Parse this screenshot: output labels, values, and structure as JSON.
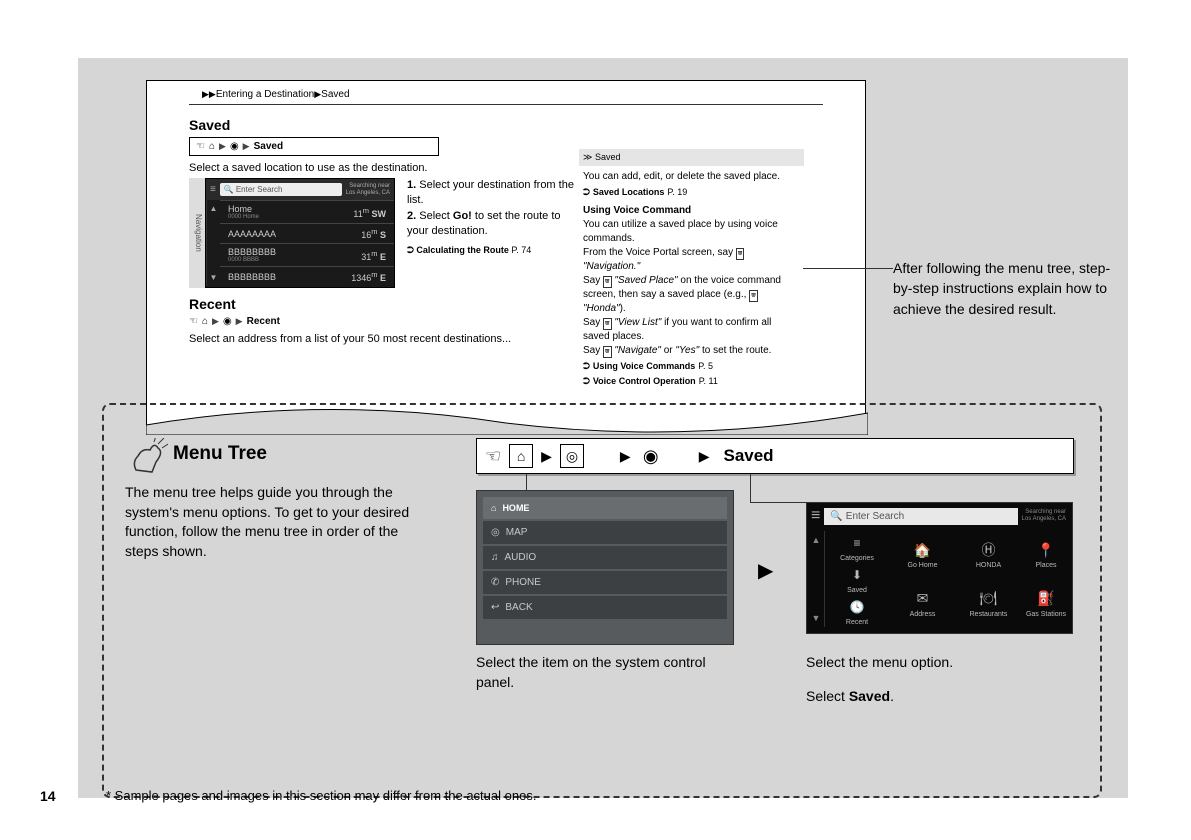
{
  "pageNumber": "14",
  "breadcrumb": {
    "arrprefix": "▶▶",
    "part1": "Entering a Destination",
    "arr": "▶",
    "part2": "Saved"
  },
  "saved": {
    "title": "Saved",
    "pathLabel": "Saved",
    "desc": "Select a saved location to use as the destination.",
    "searchPlaceholder": "Enter Search",
    "searchLoc1": "Searching near",
    "searchLoc2": "Los Angeles, CA",
    "rows": [
      {
        "name": "Home",
        "sub": "0000 Home",
        "dist": "11",
        "unit": "SW"
      },
      {
        "name": "AAAAAAAA",
        "sub": "",
        "dist": "16",
        "unit": "S"
      },
      {
        "name": "BBBBBBBB",
        "sub": "0000 BBBB",
        "dist": "31",
        "unit": "E"
      },
      {
        "name": "BBBBBBBB",
        "sub": "",
        "dist": "1346",
        "unit": "E"
      }
    ],
    "inst1num": "1.",
    "inst1": "Select your destination from the list.",
    "inst2num": "2.",
    "inst2a": "Select ",
    "inst2b": "Go!",
    "inst2c": " to set the route to your destination.",
    "ref": "Calculating the Route",
    "refPage": "P. 74"
  },
  "navSide": "Navigation",
  "sidebarRight": {
    "header": "Saved",
    "body1": "You can add, edit, or delete the saved place.",
    "ref1": "Saved Locations",
    "ref1p": "P. 19",
    "sub1": "Using Voice Command",
    "body2": "You can utilize a saved place by using voice commands.",
    "body3a": "From the Voice Portal screen, say ",
    "body3b": "\"Navigation.\"",
    "body4a": "Say ",
    "body4b": "\"Saved Place\"",
    "body4c": " on the voice command screen, then say a saved place (e.g., ",
    "body4d": "\"Honda\"",
    "body4e": ").",
    "body5a": "Say ",
    "body5b": "\"View List\"",
    "body5c": " if you want to confirm all saved places.",
    "body6a": "Say ",
    "body6b": "\"Navigate\"",
    "body6c": " or ",
    "body6d": "\"Yes\"",
    "body6e": " to set the route.",
    "ref2": "Using Voice Commands",
    "ref2p": "P. 5",
    "ref3": "Voice Control Operation",
    "ref3p": "P. 11"
  },
  "recent": {
    "title": "Recent",
    "pathLabel": "Recent",
    "desc": "Select an address from a list of your 50 most recent destinations..."
  },
  "callout1": "After following the menu tree, step-by-step instructions explain how to achieve the desired result.",
  "menuTree": {
    "title": "Menu Tree",
    "desc": "The menu tree helps guide you through the system's menu options. To get to your desired function, follow the menu tree in order of the steps shown.",
    "barLabel": "Saved"
  },
  "panel": {
    "rows": [
      {
        "icon": "⌂",
        "label": "HOME"
      },
      {
        "icon": "◎",
        "label": "MAP"
      },
      {
        "icon": "♫",
        "label": "AUDIO"
      },
      {
        "icon": "✆",
        "label": "PHONE"
      },
      {
        "icon": "↩",
        "label": "BACK"
      }
    ]
  },
  "navScreen": {
    "searchPlaceholder": "Enter Search",
    "searchLoc1": "Searching near",
    "searchLoc2": "Los Angeles, CA",
    "cells": [
      {
        "icon": "🏠",
        "label": "Go Home"
      },
      {
        "icon": "Ⓗ",
        "label": "HONDA"
      },
      {
        "icon": "📍",
        "label": "Places"
      },
      {
        "icon": "✉",
        "label": "Address"
      },
      {
        "icon": "🍽",
        "label": "Restaurants"
      },
      {
        "icon": "⛽",
        "label": "Gas Stations"
      }
    ],
    "rightCells": [
      {
        "icon": "≡",
        "label": "Categories"
      },
      {
        "icon": "⬇",
        "label": "Saved"
      },
      {
        "icon": "🕓",
        "label": "Recent"
      }
    ]
  },
  "caption1": "Select the item on the system control panel.",
  "caption2a": "Select the menu option.",
  "caption2b_pre": "Select ",
  "caption2b_bold": "Saved",
  "caption2b_post": ".",
  "footnote": "* Sample pages and images in this section may differ from the actual ones."
}
